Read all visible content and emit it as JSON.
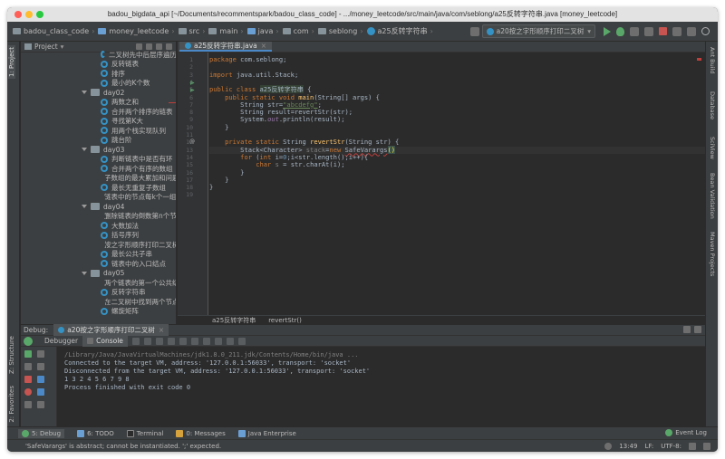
{
  "window": {
    "title": "badou_bigdata_api [~/Documents/recommentspark/badou_class_code] - .../money_leetcode/src/main/java/com/seblong/a25反转字符串.java [money_leetcode]"
  },
  "breadcrumbs": [
    "badou_class_code",
    "money_leetcode",
    "src",
    "main",
    "java",
    "com",
    "seblong",
    "a25反转字符串"
  ],
  "run_config": "a20按之字形顺序打印二叉树",
  "project_panel": {
    "title": "Project",
    "tree": [
      {
        "type": "file",
        "label": "二叉树先中后层序遍历"
      },
      {
        "type": "file",
        "label": "反转链表"
      },
      {
        "type": "file",
        "label": "排序"
      },
      {
        "type": "file",
        "label": "最小的K个数"
      },
      {
        "type": "folder",
        "label": "day02"
      },
      {
        "type": "file",
        "label": "两数之和"
      },
      {
        "type": "file",
        "label": "合并两个排序的链表"
      },
      {
        "type": "file",
        "label": "寻找第K大"
      },
      {
        "type": "file",
        "label": "用两个栈实现队列"
      },
      {
        "type": "file",
        "label": "跳台阶"
      },
      {
        "type": "folder",
        "label": "day03"
      },
      {
        "type": "file",
        "label": "判断链表中是否有环"
      },
      {
        "type": "file",
        "label": "合并两个有序的数组"
      },
      {
        "type": "file",
        "label": "子数组的最大累加和问题"
      },
      {
        "type": "file",
        "label": "最长无重复子数组"
      },
      {
        "type": "file",
        "label": "链表中的节点每k个一组翻转"
      },
      {
        "type": "folder",
        "label": "day04"
      },
      {
        "type": "file",
        "label": "删除链表的倒数第n个节点"
      },
      {
        "type": "file",
        "label": "大数加法"
      },
      {
        "type": "file",
        "label": "括号序列"
      },
      {
        "type": "file",
        "label": "按之字形顺序打印二叉树"
      },
      {
        "type": "file",
        "label": "最长公共子串"
      },
      {
        "type": "file",
        "label": "链表中的入口结点"
      },
      {
        "type": "folder",
        "label": "day05"
      },
      {
        "type": "file",
        "label": "两个链表的第一个公共结点"
      },
      {
        "type": "file",
        "label": "反转字符串"
      },
      {
        "type": "file",
        "label": "在二叉树中找到两个节点的最近公共祖先"
      },
      {
        "type": "file",
        "label": "螺旋矩阵"
      }
    ]
  },
  "editor": {
    "tab": "a25反转字符串.java",
    "line_numbers": [
      "1",
      "2",
      "3",
      "4",
      "5",
      "6",
      "7",
      "8",
      "9",
      "10",
      "11",
      "12",
      "13",
      "14",
      "15",
      "16",
      "17",
      "18",
      "19"
    ],
    "code": {
      "l1_kw": "package",
      "l1_rest": " com.seblong;",
      "l3_kw": "import",
      "l3_rest": " java.util.Stack;",
      "l5_kw": "public class",
      "l5_cls": "a25反转字符串",
      "l5_rest": " {",
      "l6_kw": "public static void",
      "l6_fn": "main",
      "l6_rest": "(String[] args) {",
      "l7_a": "String str=",
      "l7_str": "\"abcdefg\"",
      "l7_b": ";",
      "l8": "String result=revertStr(str);",
      "l9_a": "System.",
      "l9_out": "out",
      "l9_b": ".println(result);",
      "l10": "}",
      "l12_kw": "private static",
      "l12_a": " String ",
      "l12_fn": "revertStr",
      "l12_b": "(String str) {",
      "l13_a": "Stack<Character> ",
      "l13_var": "stack",
      "l13_eq": "=",
      "l13_new": "new",
      "l13_cls": "SafeVarargs",
      "l13_paren": "()",
      "l14_kw": "for",
      "l14_a": " (",
      "l14_int": "int",
      "l14_b": " i=",
      "l14_n0": "0",
      "l14_c": ";i<str.length();i++){",
      "l15_kw": "char",
      "l15_var": "s",
      "l15_rest": " = str.charAt(i);",
      "l16": "}",
      "l17": "}",
      "l18": "}"
    },
    "footer": [
      "a25反转字符串",
      "revertStr()"
    ]
  },
  "debug": {
    "label": "Debug:",
    "config_tab": "a20按之字形顺序打印二叉树",
    "tabs": [
      "Debugger",
      "Console"
    ],
    "console": [
      "/Library/Java/JavaVirtualMachines/jdk1.8.0_211.jdk/Contents/Home/bin/java ...",
      "Connected to the target VM, address: '127.0.0.1:56033', transport: 'socket'",
      "Disconnected from the target VM, address: '127.0.0.1:56033', transport: 'socket'",
      "1 3 2 4 5 6 7 9 8",
      "Process finished with exit code 0"
    ]
  },
  "left_stripe": [
    "1: Project",
    "Z: Structure",
    "2: Favorites"
  ],
  "right_stripe": [
    "Ant Build",
    "Database",
    "SciView",
    "Bean Validation",
    "Maven Projects"
  ],
  "bottom_tabs": [
    "5: Debug",
    "6: TODO",
    "Terminal",
    "0: Messages",
    "Java Enterprise"
  ],
  "event_log": "Event Log",
  "status": {
    "message": "'SafeVarargs' is abstract; cannot be instantiated. ';' expected.",
    "position": "13:49",
    "line_sep": "LF:",
    "encoding": "UTF-8:"
  },
  "colors": {
    "keyword": "#cc7832",
    "string": "#6a8759",
    "number": "#6897bb",
    "function": "#ffc66d",
    "error": "#bc3f3c"
  }
}
